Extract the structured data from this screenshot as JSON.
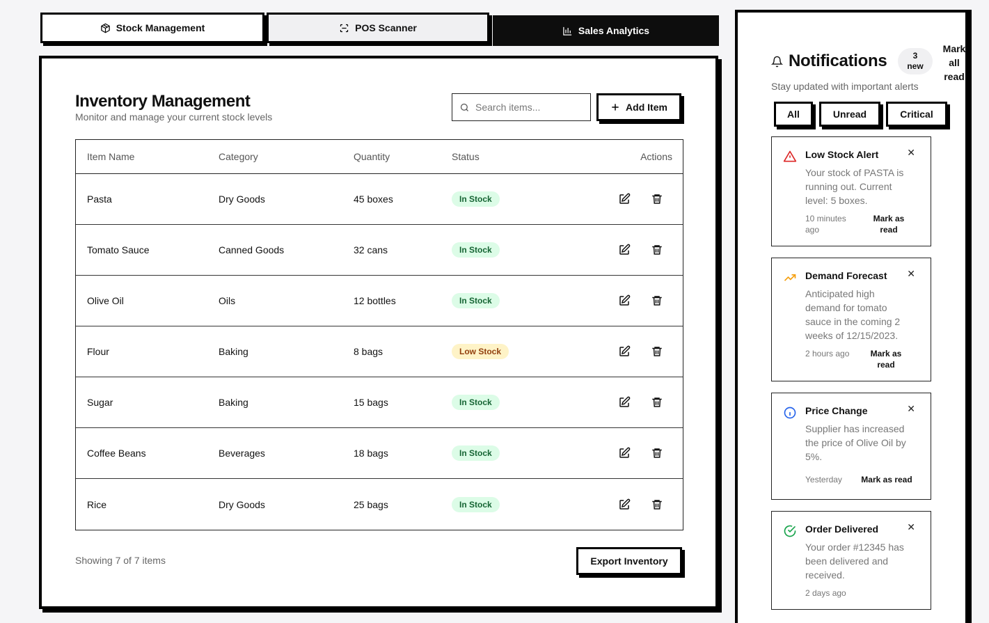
{
  "tabs": [
    {
      "label": "Stock Management",
      "icon": "package-icon"
    },
    {
      "label": "POS Scanner",
      "icon": "scan-icon"
    },
    {
      "label": "Sales Analytics",
      "icon": "bar-chart-icon"
    }
  ],
  "inventory": {
    "title": "Inventory Management",
    "subtitle": "Monitor and manage your current stock levels",
    "search_placeholder": "Search items...",
    "add_label": "Add Item",
    "columns": {
      "name": "Item Name",
      "category": "Category",
      "quantity": "Quantity",
      "status": "Status",
      "actions": "Actions"
    },
    "rows": [
      {
        "name": "Pasta",
        "category": "Dry Goods",
        "quantity": "45 boxes",
        "status": "In Stock"
      },
      {
        "name": "Tomato Sauce",
        "category": "Canned Goods",
        "quantity": "32 cans",
        "status": "In Stock"
      },
      {
        "name": "Olive Oil",
        "category": "Oils",
        "quantity": "12 bottles",
        "status": "In Stock"
      },
      {
        "name": "Flour",
        "category": "Baking",
        "quantity": "8 bags",
        "status": "Low Stock"
      },
      {
        "name": "Sugar",
        "category": "Baking",
        "quantity": "15 bags",
        "status": "In Stock"
      },
      {
        "name": "Coffee Beans",
        "category": "Beverages",
        "quantity": "18 bags",
        "status": "In Stock"
      },
      {
        "name": "Rice",
        "category": "Dry Goods",
        "quantity": "25 bags",
        "status": "In Stock"
      }
    ],
    "showing": "Showing 7 of 7 items",
    "export_label": "Export Inventory"
  },
  "notifications": {
    "title": "Notifications",
    "count_number": "3",
    "count_label": "new",
    "mark_all_lines": [
      "Mark",
      "all",
      "read"
    ],
    "subtitle": "Stay updated with important alerts",
    "filters": [
      "All",
      "Unread",
      "Critical"
    ],
    "items": [
      {
        "title": "Low Stock Alert",
        "message": "Your stock of PASTA is running out. Current level: 5 boxes.",
        "time": "10 minutes ago",
        "mark": "Mark as read",
        "icon": "alert-triangle-icon",
        "color": "#dc2626"
      },
      {
        "title": "Demand Forecast",
        "message": "Anticipated high demand for tomato sauce in the coming 2 weeks of 12/15/2023.",
        "time": "2 hours ago",
        "mark": "Mark as read",
        "icon": "trending-up-icon",
        "color": "#f59e0b"
      },
      {
        "title": "Price Change",
        "message": "Supplier has increased the price of Olive Oil by 5%.",
        "time": "Yesterday",
        "mark": "Mark as read",
        "icon": "info-icon",
        "color": "#2563eb"
      },
      {
        "title": "Order Delivered",
        "message": "Your order #12345 has been delivered and received.",
        "time": "2 days ago",
        "mark": "",
        "icon": "check-circle-icon",
        "color": "#16a34a"
      }
    ]
  }
}
